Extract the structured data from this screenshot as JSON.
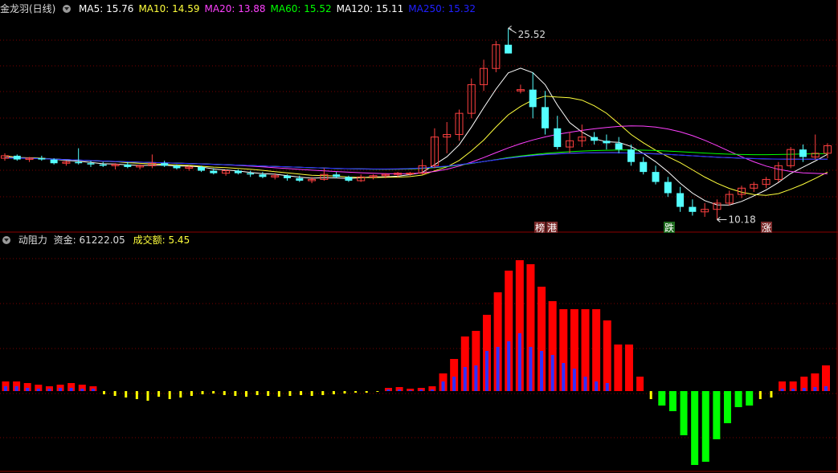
{
  "main_header": {
    "title": "金龙羽(日线)",
    "mas": [
      {
        "label": "MA5: 15.76",
        "color": "#ffffff"
      },
      {
        "label": "MA10: 14.59",
        "color": "#ffff3c"
      },
      {
        "label": "MA20: 13.88",
        "color": "#ff40ff"
      },
      {
        "label": "MA60: 15.52",
        "color": "#00ff00"
      },
      {
        "label": "MA120: 15.11",
        "color": "#ffffff"
      },
      {
        "label": "MA250: 15.32",
        "color": "#2020ff"
      }
    ]
  },
  "sub_header": {
    "title": "动阻力",
    "fund": "资金: 61222.05",
    "volume": "成交额: 5.45"
  },
  "markers": {
    "high": "25.52",
    "low": "10.18"
  },
  "tags": [
    {
      "text": "榜",
      "color": "#ffffff",
      "bg": "#7a2a2a"
    },
    {
      "text": "港",
      "color": "#ffffff",
      "bg": "#7a2a2a"
    },
    {
      "text": "跌",
      "color": "#ffffff",
      "bg": "#1e6b1e"
    },
    {
      "text": "涨",
      "color": "#ffffff",
      "bg": "#7a2a2a"
    }
  ],
  "colors": {
    "up": "#ff4040",
    "down": "#54ffff",
    "grid": "#7a0000",
    "border": "#8b0000",
    "bar_red": "#ff0000",
    "bar_green": "#00ff00",
    "bar_yellow": "#ffff00",
    "bar_blue": "#3030ff"
  },
  "chart_data": [
    {
      "type": "candlestick",
      "series_names": [
        "MA5",
        "MA10",
        "MA20",
        "MA60",
        "MA120",
        "MA250"
      ],
      "high": 25.52,
      "low": 10.18,
      "ohlc": [
        [
          15.1,
          15.5,
          14.9,
          15.3
        ],
        [
          15.3,
          15.4,
          14.9,
          15.0
        ],
        [
          15.0,
          15.2,
          14.8,
          15.1
        ],
        [
          15.1,
          15.3,
          14.9,
          15.0
        ],
        [
          15.0,
          15.1,
          14.6,
          14.7
        ],
        [
          14.7,
          14.9,
          14.5,
          14.8
        ],
        [
          14.8,
          15.9,
          14.6,
          14.7
        ],
        [
          14.7,
          14.9,
          14.4,
          14.6
        ],
        [
          14.6,
          14.8,
          14.4,
          14.5
        ],
        [
          14.5,
          14.7,
          14.2,
          14.6
        ],
        [
          14.6,
          14.8,
          14.3,
          14.4
        ],
        [
          14.4,
          14.6,
          14.2,
          14.5
        ],
        [
          14.5,
          15.4,
          14.3,
          14.7
        ],
        [
          14.7,
          14.9,
          14.4,
          14.5
        ],
        [
          14.5,
          14.6,
          14.2,
          14.3
        ],
        [
          14.3,
          14.5,
          14.1,
          14.4
        ],
        [
          14.4,
          14.5,
          14.0,
          14.1
        ],
        [
          14.1,
          14.3,
          13.8,
          13.9
        ],
        [
          13.9,
          14.2,
          13.7,
          14.1
        ],
        [
          14.1,
          14.2,
          13.8,
          13.9
        ],
        [
          13.9,
          14.1,
          13.6,
          13.8
        ],
        [
          13.8,
          14.0,
          13.5,
          13.6
        ],
        [
          13.6,
          13.9,
          13.4,
          13.7
        ],
        [
          13.7,
          13.8,
          13.3,
          13.5
        ],
        [
          13.5,
          13.7,
          13.2,
          13.3
        ],
        [
          13.3,
          13.6,
          13.1,
          13.4
        ],
        [
          13.4,
          14.3,
          13.3,
          13.8
        ],
        [
          13.8,
          14.0,
          13.5,
          13.6
        ],
        [
          13.6,
          13.7,
          13.2,
          13.3
        ],
        [
          13.3,
          13.8,
          13.2,
          13.6
        ],
        [
          13.6,
          13.8,
          13.4,
          13.7
        ],
        [
          13.7,
          13.9,
          13.5,
          13.8
        ],
        [
          13.8,
          14.0,
          13.6,
          13.9
        ],
        [
          13.9,
          14.0,
          13.7,
          13.9
        ],
        [
          13.9,
          15.0,
          13.8,
          14.5
        ],
        [
          14.5,
          17.5,
          14.3,
          16.8
        ],
        [
          16.8,
          18.0,
          15.5,
          17.0
        ],
        [
          17.0,
          19.0,
          16.5,
          18.7
        ],
        [
          18.7,
          21.5,
          18.3,
          21.0
        ],
        [
          21.0,
          23.0,
          20.5,
          22.3
        ],
        [
          22.3,
          24.5,
          22.0,
          24.2
        ],
        [
          24.2,
          25.52,
          23.5,
          23.5
        ],
        [
          20.5,
          21.0,
          20.3,
          20.6
        ],
        [
          20.6,
          22.0,
          18.3,
          19.2
        ],
        [
          19.2,
          20.5,
          17.0,
          17.5
        ],
        [
          17.5,
          18.5,
          15.8,
          16.0
        ],
        [
          16.0,
          17.2,
          15.5,
          16.5
        ],
        [
          16.5,
          17.8,
          16.0,
          16.8
        ],
        [
          16.8,
          17.2,
          16.2,
          16.5
        ],
        [
          16.5,
          17.0,
          15.8,
          16.3
        ],
        [
          16.3,
          16.8,
          15.5,
          15.8
        ],
        [
          15.8,
          16.2,
          14.5,
          14.8
        ],
        [
          14.8,
          15.2,
          13.8,
          14.0
        ],
        [
          14.0,
          14.5,
          13.0,
          13.2
        ],
        [
          13.2,
          13.6,
          12.0,
          12.3
        ],
        [
          12.3,
          12.8,
          10.8,
          11.2
        ],
        [
          11.2,
          11.8,
          10.5,
          10.8
        ],
        [
          10.8,
          11.5,
          10.4,
          11.0
        ],
        [
          11.0,
          11.8,
          10.18,
          11.5
        ],
        [
          11.5,
          12.5,
          11.3,
          12.2
        ],
        [
          12.2,
          12.9,
          11.9,
          12.7
        ],
        [
          12.7,
          13.2,
          12.4,
          13.0
        ],
        [
          13.0,
          13.6,
          12.7,
          13.4
        ],
        [
          13.4,
          14.8,
          13.2,
          14.5
        ],
        [
          14.5,
          16.0,
          14.3,
          15.8
        ],
        [
          15.8,
          16.2,
          14.8,
          15.2
        ],
        [
          15.2,
          17.0,
          15.0,
          15.5
        ],
        [
          15.5,
          16.3,
          15.1,
          16.1
        ]
      ]
    },
    {
      "type": "bar",
      "series": [
        {
          "name": "动阻力",
          "values": [
            12,
            12,
            10,
            8,
            6,
            8,
            10,
            8,
            6,
            -4,
            -6,
            -8,
            -10,
            -12,
            -7,
            -10,
            -8,
            -6,
            -4,
            -3,
            -5,
            -6,
            -7,
            -5,
            -6,
            -7,
            -6,
            -5,
            -6,
            -5,
            -4,
            -3,
            -2,
            -2,
            -1,
            4,
            5,
            3,
            4,
            6,
            22,
            40,
            68,
            75,
            95,
            123,
            150,
            163,
            158,
            130,
            112,
            102,
            102,
            102,
            102,
            88,
            58,
            58,
            18,
            -10,
            -18,
            -25,
            -55,
            -92,
            -88,
            -60,
            -40,
            -20,
            -18,
            -10,
            -8,
            12,
            12,
            18,
            22,
            32
          ]
        },
        {
          "name": "资金",
          "values": [
            6,
            6,
            4,
            3,
            3,
            4,
            4,
            3,
            3,
            0,
            0,
            0,
            0,
            0,
            0,
            0,
            0,
            0,
            0,
            0,
            0,
            0,
            0,
            0,
            0,
            0,
            0,
            0,
            0,
            0,
            0,
            0,
            0,
            0,
            0,
            2,
            2,
            1,
            2,
            2,
            12,
            18,
            30,
            32,
            50,
            55,
            62,
            72,
            55,
            50,
            45,
            35,
            28,
            18,
            12,
            10,
            0,
            0,
            0,
            0,
            0,
            0,
            0,
            0,
            0,
            0,
            0,
            0,
            0,
            0,
            0,
            3,
            3,
            4,
            5,
            6
          ]
        }
      ]
    }
  ]
}
